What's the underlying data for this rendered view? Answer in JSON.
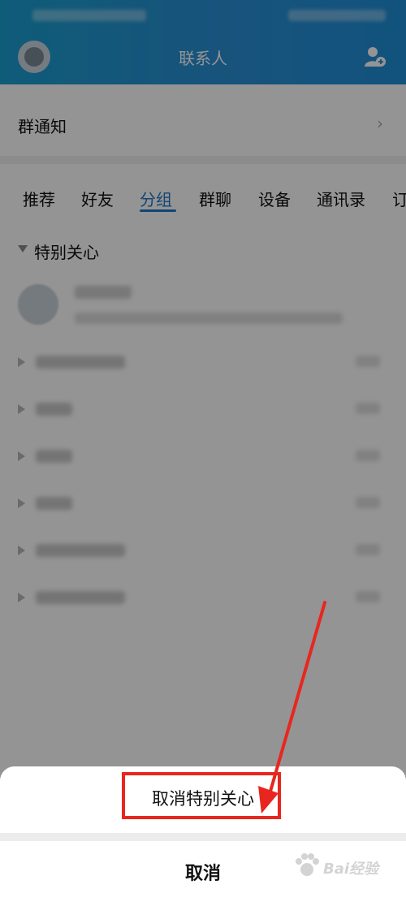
{
  "header": {
    "title": "联系人"
  },
  "group_notice": {
    "label": "群通知"
  },
  "tabs": [
    {
      "label": "推荐"
    },
    {
      "label": "好友"
    },
    {
      "label": "分组"
    },
    {
      "label": "群聊"
    },
    {
      "label": "设备"
    },
    {
      "label": "通讯录"
    },
    {
      "label": "订"
    }
  ],
  "active_tab": "分组",
  "sections": {
    "special_care": "特别关心"
  },
  "action_sheet": {
    "option_label": "取消特别关心",
    "cancel_label": "取消"
  },
  "colors": {
    "accent": "#1e78c8",
    "highlight": "#e8261f",
    "header": "#1a9fd0"
  },
  "icons": [
    "add-contact-icon",
    "avatar",
    "caret-down-icon",
    "caret-right-icon",
    "arrow-annotation"
  ],
  "watermark": {
    "text": "Bai经验"
  }
}
